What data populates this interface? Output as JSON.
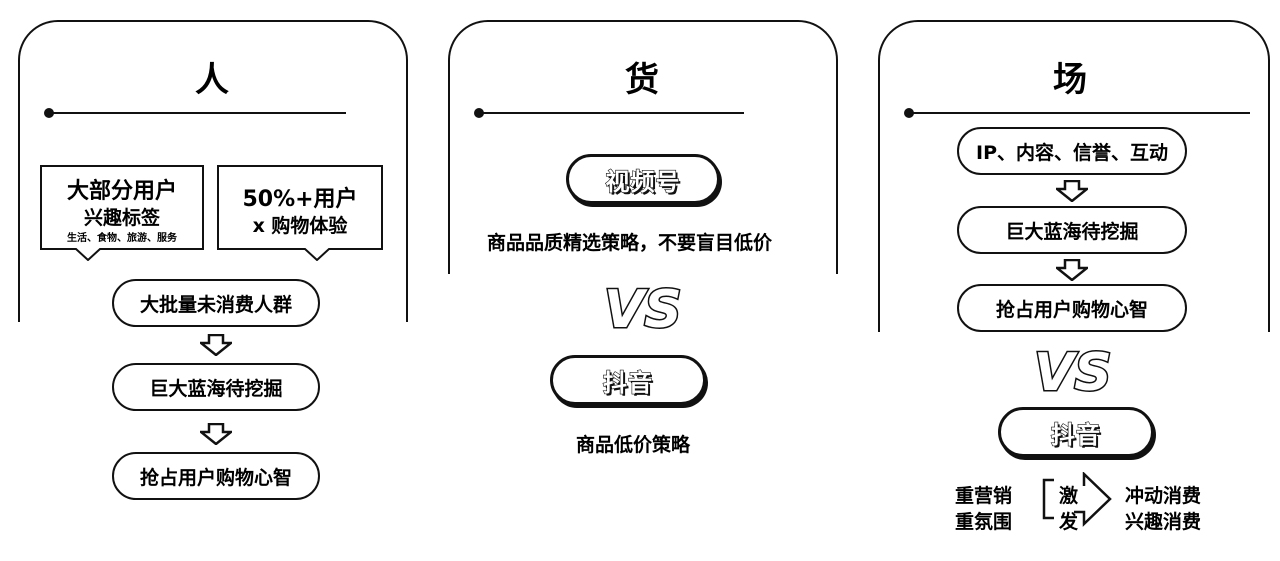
{
  "panels": {
    "people": {
      "title": "人",
      "callout_left": {
        "line1": "大部分用户",
        "line2": "兴趣标签",
        "line3": "生活、食物、旅游、服务"
      },
      "callout_right": {
        "line1": "50%+用户",
        "line2": "x 购物体验"
      },
      "flow": [
        "大批量未消费人群",
        "巨大蓝海待挖掘",
        "抢占用户购物心智"
      ]
    },
    "goods": {
      "title": "货",
      "top_tag": "视频号",
      "top_text": "商品品质精选策略，不要盲目低价",
      "vs": "VS",
      "bottom_tag": "抖音",
      "bottom_text": "商品低价策略"
    },
    "place": {
      "title": "场",
      "flow": [
        "IP、内容、信誉、互动",
        "巨大蓝海待挖掘",
        "抢占用户购物心智"
      ],
      "vs": "VS",
      "bottom_tag": "抖音",
      "left_lines": [
        "重营销",
        "重氛围"
      ],
      "middle_lines": [
        "激",
        "发"
      ],
      "right_lines": [
        "冲动消费",
        "兴趣消费"
      ]
    }
  },
  "colors": {
    "ink": "#111111",
    "background": "#ffffff"
  }
}
